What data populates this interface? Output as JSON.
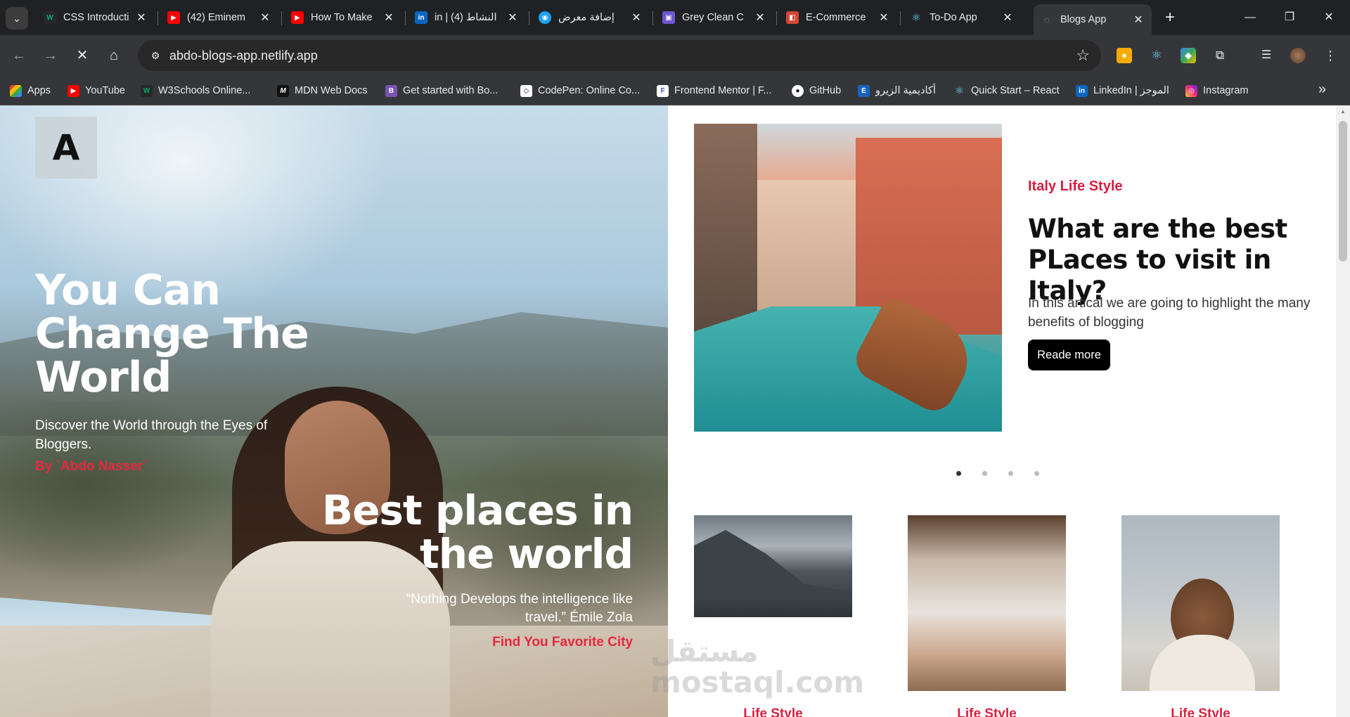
{
  "tabs": [
    {
      "title": "CSS Introducti",
      "favicon": "W3",
      "color": "#04aa6d"
    },
    {
      "title": "(42) Eminem",
      "favicon": "▶",
      "color": "#ff0000"
    },
    {
      "title": "How To Make",
      "favicon": "▶",
      "color": "#ff0000"
    },
    {
      "title": "in | النشاط (4)",
      "favicon": "in",
      "color": "#0a66c2"
    },
    {
      "title": "إضافة معرض",
      "favicon": "◉",
      "color": "#1da1f2"
    },
    {
      "title": "Grey Clean C",
      "favicon": "▣",
      "color": "#6e56cf"
    },
    {
      "title": "E-Commerce",
      "favicon": "🛍",
      "color": "#d14836"
    },
    {
      "title": "To-Do App",
      "favicon": "⚛",
      "color": "#61dafb"
    },
    {
      "title": "Blogs App",
      "favicon": "◌",
      "color": "#9aa0a6"
    }
  ],
  "address_bar": {
    "url": "abdo-blogs-app.netlify.app"
  },
  "bookmarks": [
    {
      "label": "Apps",
      "icon": "grid",
      "color": "#ea4335"
    },
    {
      "label": "YouTube",
      "icon": "▶",
      "color": "#ff0000"
    },
    {
      "label": "W3Schools Online...",
      "icon": "W",
      "color": "#04aa6d"
    },
    {
      "label": "MDN Web Docs",
      "icon": "M",
      "color": "#111111"
    },
    {
      "label": "Get started with Bo...",
      "icon": "B",
      "color": "#7952b3"
    },
    {
      "label": "CodePen: Online Co...",
      "icon": "◇",
      "color": "#000000"
    },
    {
      "label": "Frontend Mentor | F...",
      "icon": "F",
      "color": "#ffffff"
    },
    {
      "label": "GitHub",
      "icon": "●",
      "color": "#ffffff"
    },
    {
      "label": "أكاديمية الزيرو",
      "icon": "E",
      "color": "#1565c0"
    },
    {
      "label": "Quick Start – React",
      "icon": "⚛",
      "color": "#61dafb"
    },
    {
      "label": "LinkedIn | الموجز",
      "icon": "in",
      "color": "#0a66c2"
    },
    {
      "label": "Instagram",
      "icon": "◎",
      "color": "#c13584"
    }
  ],
  "page": {
    "logo": "A",
    "hero": {
      "title": "You Can Change The World",
      "subtitle": "Discover the World through the Eyes of Bloggers.",
      "author": "By `Abdo Nasser`"
    },
    "hero2": {
      "title": "Best places in the world",
      "quote": "“Nothing Develops the intelligence like travel.” Émile Zola",
      "link": "Find You Favorite City"
    },
    "featured": {
      "category": "Italy Life Style",
      "title": "What are the best PLaces to visit in Italy?",
      "description": "In this artical we are going to highlight the many benefits of blogging",
      "button": "Reade more"
    },
    "carousel": {
      "count": 4,
      "active": 0
    },
    "cards": [
      {
        "category": "Life Style"
      },
      {
        "category": "Life Style"
      },
      {
        "category": "Life Style"
      }
    ]
  },
  "watermark": "مستقل\nmostaql.com"
}
